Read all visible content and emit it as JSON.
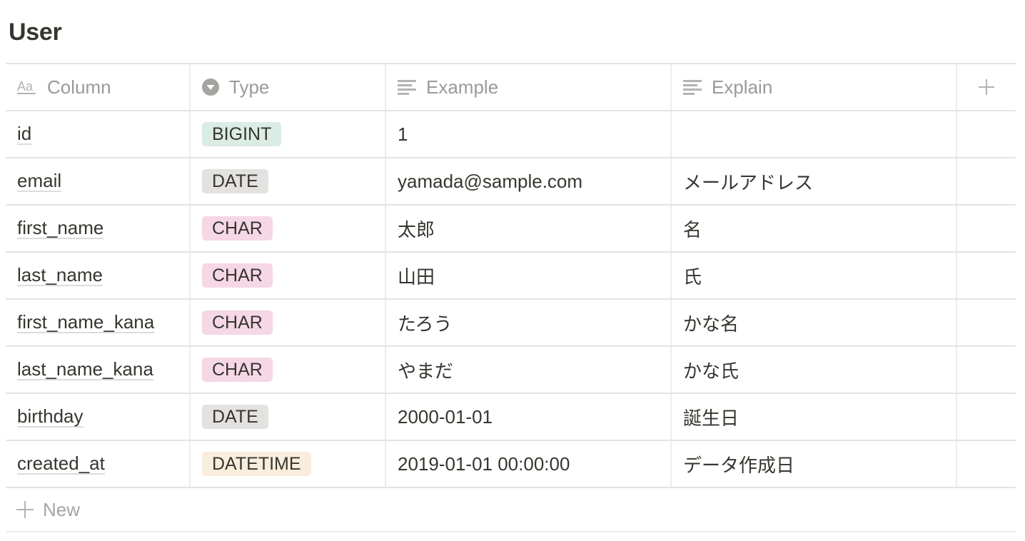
{
  "title": "User",
  "columns": [
    {
      "label": "Column",
      "icon": "title-property-icon"
    },
    {
      "label": "Type",
      "icon": "select-property-icon"
    },
    {
      "label": "Example",
      "icon": "text-property-icon"
    },
    {
      "label": "Explain",
      "icon": "text-property-icon"
    }
  ],
  "add_column_icon": "plus-icon",
  "badge_colors": {
    "BIGINT": "#dbece5",
    "DATE": "#e3e2e0",
    "CHAR": "#f5d7e6",
    "DATETIME": "#f8eedb"
  },
  "rows": [
    {
      "name": "id",
      "type": "BIGINT",
      "example": "1",
      "explain": ""
    },
    {
      "name": "email",
      "type": "DATE",
      "example": "yamada@sample.com",
      "explain": "メールアドレス"
    },
    {
      "name": "first_name",
      "type": "CHAR",
      "example": "太郎",
      "explain": "名"
    },
    {
      "name": "last_name",
      "type": "CHAR",
      "example": "山田",
      "explain": "氏"
    },
    {
      "name": "first_name_kana",
      "type": "CHAR",
      "example": "たろう",
      "explain": "かな名"
    },
    {
      "name": "last_name_kana",
      "type": "CHAR",
      "example": "やまだ",
      "explain": "かな氏"
    },
    {
      "name": "birthday",
      "type": "DATE",
      "example": "2000-01-01",
      "explain": "誕生日"
    },
    {
      "name": "created_at",
      "type": "DATETIME",
      "example": "2019-01-01 00:00:00",
      "explain": "データ作成日"
    }
  ],
  "new_row_label": "New"
}
